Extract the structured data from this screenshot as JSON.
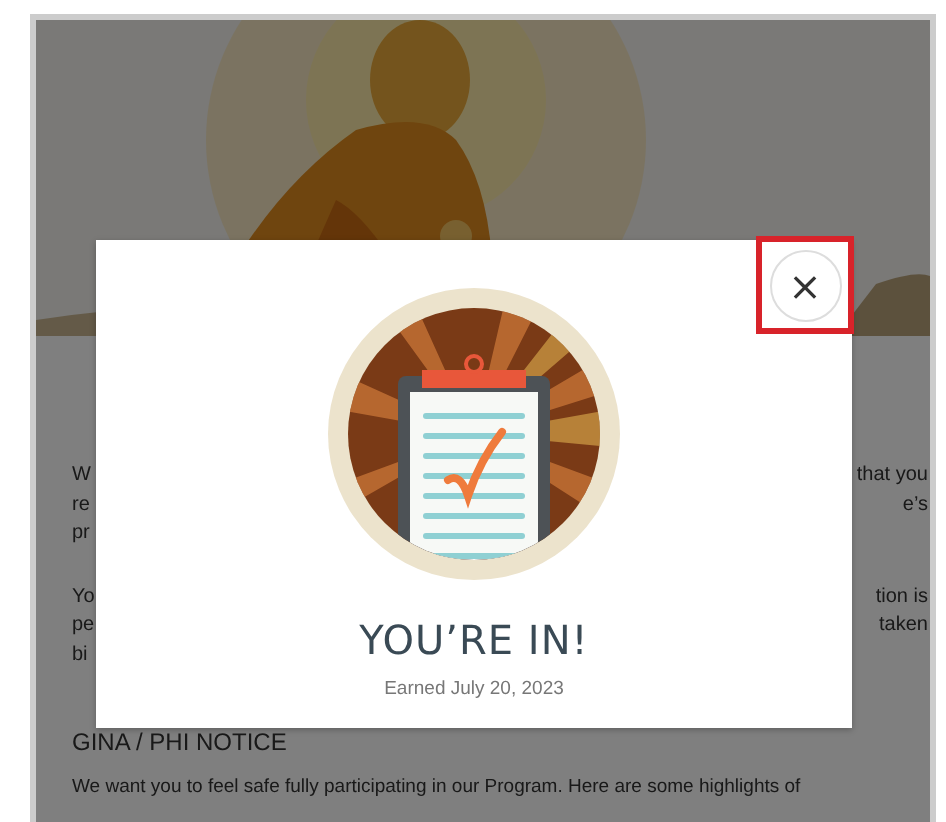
{
  "page": {
    "paragraphs": [
      {
        "lines": [
          {
            "left": "W",
            "right": "that you"
          },
          {
            "left": "re",
            "right": "e’s"
          },
          {
            "left": "pr"
          }
        ]
      },
      {
        "lines": [
          {
            "left": "Yo",
            "right": "tion is"
          },
          {
            "left": "pe",
            "right": "taken"
          },
          {
            "left": "bi"
          }
        ]
      }
    ],
    "heading": "GINA / PHI NOTICE",
    "last_paragraph": "We want you to feel safe fully participating in our Program. Here are some highlights of"
  },
  "modal": {
    "close_button": {
      "label": "×",
      "focused": true
    },
    "title": "YOU’RE IN!",
    "earned": "Earned July 20, 2023"
  }
}
